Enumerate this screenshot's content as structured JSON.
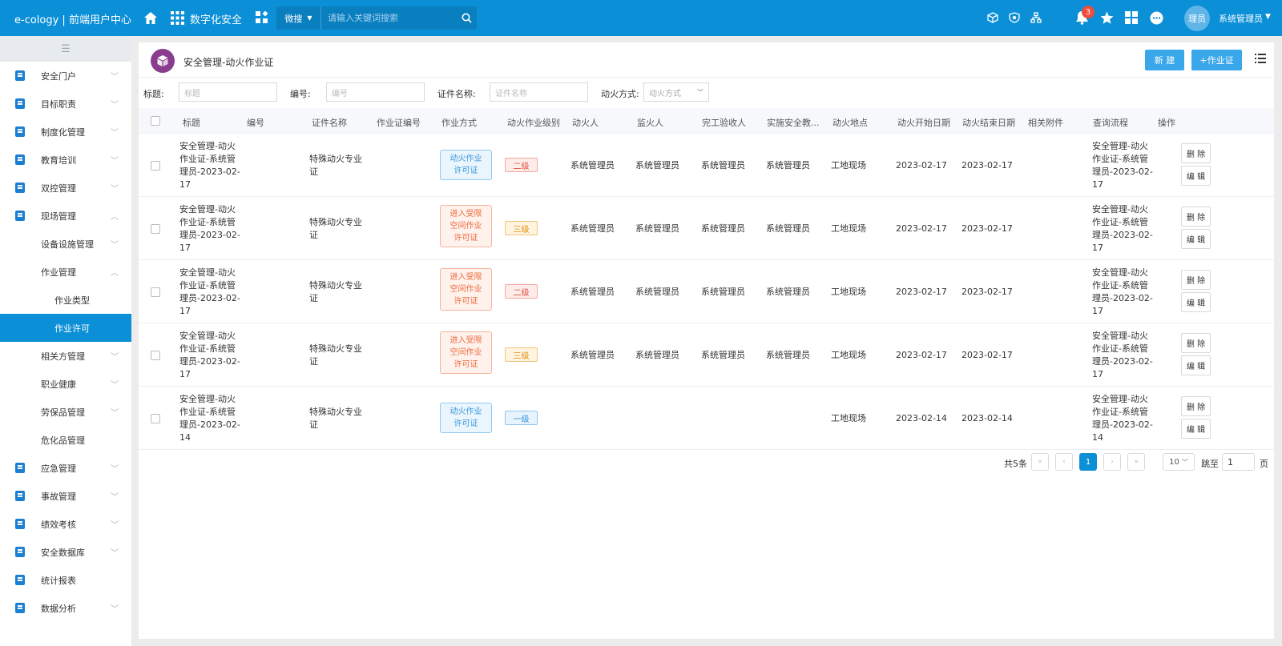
{
  "topbar": {
    "brand": "e-cology | 前端用户中心",
    "module": "数字化安全",
    "search_type": "微搜",
    "search_placeholder": "请输入关键词搜索",
    "notification_count": "3",
    "avatar_text": "理员",
    "username": "系统管理员"
  },
  "sidebar": {
    "items": [
      {
        "label": "安全门户"
      },
      {
        "label": "目标职责"
      },
      {
        "label": "制度化管理"
      },
      {
        "label": "教育培训"
      },
      {
        "label": "双控管理"
      },
      {
        "label": "现场管理"
      },
      {
        "label": "设备设施管理"
      },
      {
        "label": "作业管理"
      },
      {
        "label": "作业类型"
      },
      {
        "label": "作业许可"
      },
      {
        "label": "相关方管理"
      },
      {
        "label": "职业健康"
      },
      {
        "label": "劳保品管理"
      },
      {
        "label": "危化品管理"
      },
      {
        "label": "应急管理"
      },
      {
        "label": "事故管理"
      },
      {
        "label": "绩效考核"
      },
      {
        "label": "安全数据库"
      },
      {
        "label": "统计报表"
      },
      {
        "label": "数据分析"
      }
    ]
  },
  "page": {
    "title": "安全管理-动火作业证",
    "new_label": "新 建",
    "add_cert_label": "+作业证"
  },
  "filters": {
    "title_label": "标题:",
    "title_placeholder": "标题",
    "no_label": "编号:",
    "no_placeholder": "编号",
    "cert_label": "证件名称:",
    "cert_placeholder": "证件名称",
    "mode_label": "动火方式:",
    "mode_placeholder": "动火方式"
  },
  "table": {
    "columns": [
      "标题",
      "编号",
      "证件名称",
      "作业证编号",
      "作业方式",
      "动火作业级别",
      "动火人",
      "监火人",
      "完工验收人",
      "实施安全教...",
      "动火地点",
      "动火开始日期",
      "动火结束日期",
      "相关附件",
      "查询流程",
      "操作"
    ],
    "delete_label": "删 除",
    "edit_label": "编 辑",
    "rows": [
      {
        "title": [
          "安全管理-动火",
          "作业证-系统管",
          "理员-2023-02-",
          "17"
        ],
        "no": "",
        "cert": [
          "特殊动火专业",
          "证"
        ],
        "mode": [
          "动火作业",
          "许可证"
        ],
        "level": "二级",
        "hot": "系统管理员",
        "watch": "系统管理员",
        "accept": "系统管理员",
        "edu": "系统管理员",
        "place": "工地现场",
        "start": "2023-02-17",
        "end": "2023-02-17",
        "flow": [
          "安全管理-动火",
          "作业证-系统管",
          "理员-2023-02-",
          "17"
        ]
      },
      {
        "title": [
          "安全管理-动火",
          "作业证-系统管",
          "理员-2023-02-",
          "17"
        ],
        "no": "",
        "cert": [
          "特殊动火专业",
          "证"
        ],
        "mode": [
          "进入受限",
          "空间作业",
          "许可证"
        ],
        "level": "三级",
        "hot": "系统管理员",
        "watch": "系统管理员",
        "accept": "系统管理员",
        "edu": "系统管理员",
        "place": "工地现场",
        "start": "2023-02-17",
        "end": "2023-02-17",
        "flow": [
          "安全管理-动火",
          "作业证-系统管",
          "理员-2023-02-",
          "17"
        ]
      },
      {
        "title": [
          "安全管理-动火",
          "作业证-系统管",
          "理员-2023-02-",
          "17"
        ],
        "no": "",
        "cert": [
          "特殊动火专业",
          "证"
        ],
        "mode": [
          "进入受限",
          "空间作业",
          "许可证"
        ],
        "level": "二级",
        "hot": "系统管理员",
        "watch": "系统管理员",
        "accept": "系统管理员",
        "edu": "系统管理员",
        "place": "工地现场",
        "start": "2023-02-17",
        "end": "2023-02-17",
        "flow": [
          "安全管理-动火",
          "作业证-系统管",
          "理员-2023-02-",
          "17"
        ]
      },
      {
        "title": [
          "安全管理-动火",
          "作业证-系统管",
          "理员-2023-02-",
          "17"
        ],
        "no": "",
        "cert": [
          "特殊动火专业",
          "证"
        ],
        "mode": [
          "进入受限",
          "空间作业",
          "许可证"
        ],
        "level": "三级",
        "hot": "系统管理员",
        "watch": "系统管理员",
        "accept": "系统管理员",
        "edu": "系统管理员",
        "place": "工地现场",
        "start": "2023-02-17",
        "end": "2023-02-17",
        "flow": [
          "安全管理-动火",
          "作业证-系统管",
          "理员-2023-02-",
          "17"
        ]
      },
      {
        "title": [
          "安全管理-动火",
          "作业证-系统管",
          "理员-2023-02-",
          "14"
        ],
        "no": "",
        "cert": [
          "特殊动火专业",
          "证"
        ],
        "mode": [
          "动火作业",
          "许可证"
        ],
        "level": "一级",
        "hot": "",
        "watch": "",
        "accept": "",
        "edu": "",
        "place": "工地现场",
        "start": "2023-02-14",
        "end": "2023-02-14",
        "flow": [
          "安全管理-动火",
          "作业证-系统管",
          "理员-2023-02-",
          "14"
        ]
      }
    ]
  },
  "pager": {
    "total": "共5条",
    "current": "1",
    "page_size": "10",
    "jump_label": "跳至",
    "jump_value": "1",
    "page_unit": "页"
  },
  "colors": {
    "topbar": "#0b8fd7",
    "active_menu": "#0b8fd7",
    "primary_button": "#39a7ea"
  }
}
